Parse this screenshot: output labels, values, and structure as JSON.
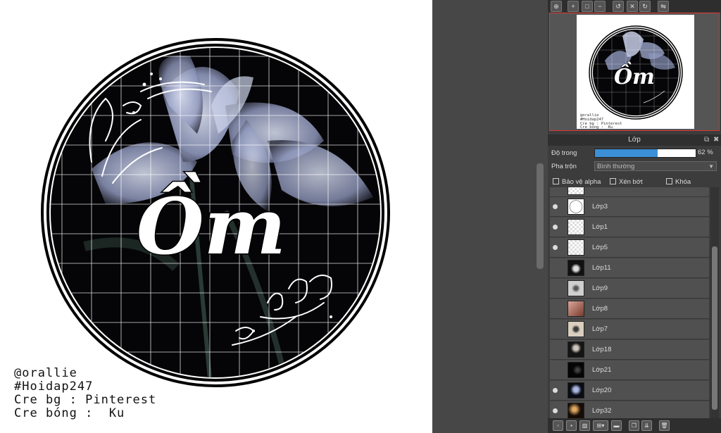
{
  "artwork": {
    "title_text": "Ồm",
    "credits": [
      "@orallie",
      "#Hoidap247",
      "Cre bg : Pinterest",
      "Cre bóng :  Ku"
    ]
  },
  "layers_panel": {
    "title": "Lớp",
    "opacity_label": "Độ trong",
    "opacity_value": "62 %",
    "opacity_fraction": 0.62,
    "blend_label": "Pha trộn",
    "blend_value": "Bình thường",
    "protect_alpha_label": "Bảo vệ alpha",
    "clip_label": "Xén bớt",
    "lock_label": "Khóa",
    "layers": [
      {
        "name": "Lớp3",
        "visible": true,
        "thumb": "circle"
      },
      {
        "name": "Lớp1",
        "visible": true,
        "thumb": "transparent"
      },
      {
        "name": "Lớp5",
        "visible": true,
        "thumb": "transparent"
      },
      {
        "name": "Lớp11",
        "visible": false,
        "thumb": "flowers-dark"
      },
      {
        "name": "Lớp9",
        "visible": false,
        "thumb": "sketch-gray"
      },
      {
        "name": "Lớp8",
        "visible": false,
        "thumb": "photo-red"
      },
      {
        "name": "Lớp7",
        "visible": false,
        "thumb": "photo-beige"
      },
      {
        "name": "Lớp18",
        "visible": false,
        "thumb": "photo-dark"
      },
      {
        "name": "Lớp21",
        "visible": false,
        "thumb": "photo-black"
      },
      {
        "name": "Lớp20",
        "visible": true,
        "thumb": "photo-blue"
      },
      {
        "name": "Lớp32",
        "visible": true,
        "thumb": "photo-warm"
      }
    ]
  },
  "colors": {
    "accent": "#3b8fd6",
    "panel_bg": "#3c3c3c",
    "navigator_border": "#dd3333"
  }
}
